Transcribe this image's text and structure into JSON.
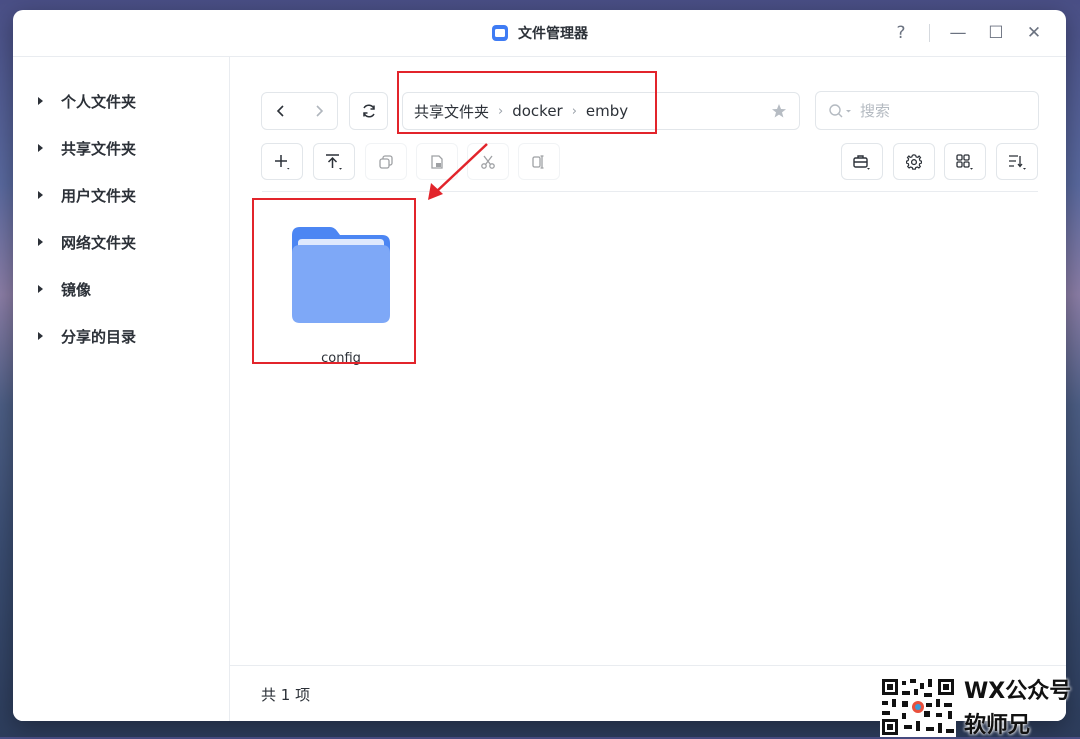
{
  "window": {
    "title": "文件管理器",
    "controls": [
      "?",
      "—",
      "☐",
      "✕"
    ]
  },
  "sidebar": {
    "items": [
      {
        "label": "个人文件夹"
      },
      {
        "label": "共享文件夹"
      },
      {
        "label": "用户文件夹"
      },
      {
        "label": "网络文件夹"
      },
      {
        "label": "镜像"
      },
      {
        "label": "分享的目录"
      }
    ]
  },
  "toolbar": {
    "path": [
      "共享文件夹",
      "docker",
      "emby"
    ],
    "path_separator": "›",
    "search_placeholder": "搜索"
  },
  "files": [
    {
      "name": "config",
      "type": "folder"
    }
  ],
  "status": {
    "count_text": "共 1 项"
  },
  "watermark": {
    "line1": "WX公众号",
    "line2": "软师兄"
  },
  "colors": {
    "accent": "#3f7cf4",
    "folder_front": "#7ea8f7",
    "folder_back": "#4c86f3",
    "highlight_box": "#e2242b"
  }
}
